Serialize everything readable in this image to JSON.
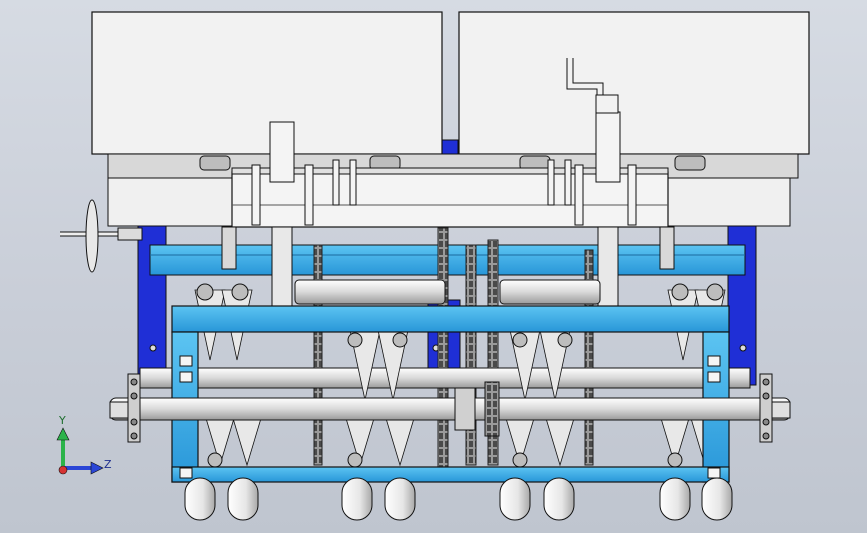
{
  "view": {
    "background_color": "#c9ced8",
    "frame_color": "#2aa3e3",
    "side_plate_color": "#1f2fd6",
    "box_color": "#f2f2f2",
    "shaft_color": "#e6e6e6",
    "outline_color": "#222222"
  },
  "triad": {
    "y_label": "Y",
    "z_label": "Z",
    "y_color": "#2bb34a",
    "z_color": "#2a46d6",
    "x_color": "#d63333"
  }
}
